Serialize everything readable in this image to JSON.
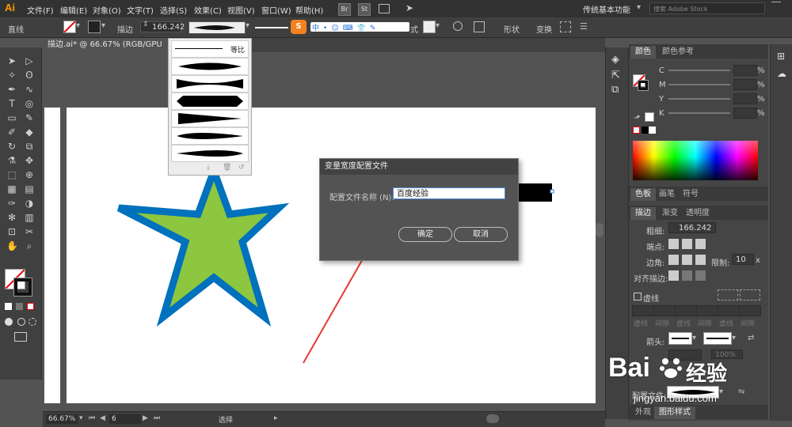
{
  "app": {
    "logo": "Ai"
  },
  "menu": [
    "文件(F)",
    "编辑(E)",
    "对象(O)",
    "文字(T)",
    "选择(S)",
    "效果(C)",
    "视图(V)",
    "窗口(W)",
    "帮助(H)"
  ],
  "menubar": {
    "bridge": "Br",
    "stock": "St",
    "workspace": "传统基本功能",
    "search_placeholder": "搜索 Adobe Stock"
  },
  "control": {
    "tool_name": "直线",
    "stroke_label": "描边",
    "stroke_value": "166.242",
    "style_label": "式",
    "shape_label": "形状",
    "transform_label": "变换"
  },
  "document": {
    "tab": "描边.ai* @ 66.67% (RGB/GPU 预览)"
  },
  "profile_dropdown": {
    "first_label": "等比"
  },
  "dialog": {
    "title": "变量宽度配置文件",
    "name_label": "配置文件名称 (N):",
    "name_value": "百度经验",
    "ok": "确定",
    "cancel": "取消"
  },
  "color_panel": {
    "tabs": [
      "颜色",
      "颜色参考"
    ],
    "channels": [
      "C",
      "M",
      "Y",
      "K"
    ],
    "percent": "%"
  },
  "swatch_tabs": [
    "色板",
    "画笔",
    "符号"
  ],
  "stroke_panel": {
    "tabs": [
      "描边",
      "渐变",
      "透明度"
    ],
    "weight_label": "粗细:",
    "weight_value": "166.242",
    "cap_label": "端点:",
    "corner_label": "边角:",
    "limit_label": "限制:",
    "limit_value": "10",
    "limit_unit": "x",
    "align_label": "对齐描边:",
    "dashed_label": "虚线",
    "dash_cells": [
      "虚线",
      "间隙",
      "虚线",
      "间隙",
      "虚线",
      "间隙"
    ],
    "arrow_label": "箭头:",
    "scale_value": "100%",
    "profile_label": "配置文件:"
  },
  "bottom_tabs": [
    "外观",
    "图形样式"
  ],
  "status": {
    "zoom": "66.67%",
    "page": "6",
    "tool": "选择"
  },
  "watermark": {
    "brand": "Bai",
    "suffix": "经验",
    "url": "jingyan.baidu.com"
  },
  "colors": {
    "star_fill": "#8dc63f",
    "star_stroke": "#0071bc",
    "arrow": "#e53935",
    "accent": "#ff9a00"
  }
}
